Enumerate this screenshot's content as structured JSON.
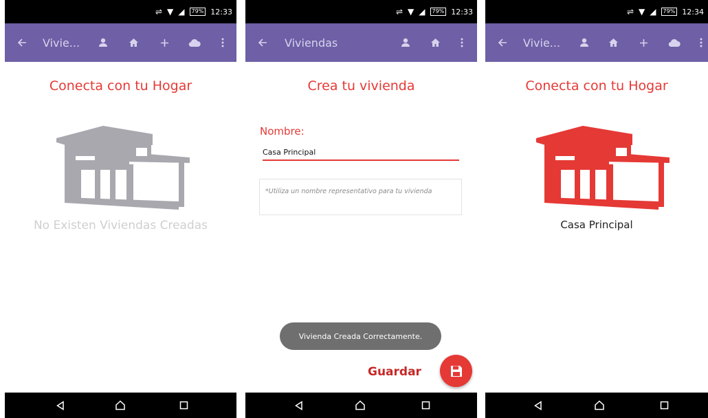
{
  "colors": {
    "accent": "#e53935",
    "appbar": "#6e5fa6",
    "house_gray": "#a8a8ae",
    "house_red": "#e53935"
  },
  "status": {
    "battery": "79%",
    "time1": "12:33",
    "time2": "12:33",
    "time3": "12:34"
  },
  "screen1": {
    "appbar_title": "Vivie...",
    "icons": [
      "back-arrow-icon",
      "person-icon",
      "home-icon",
      "add-icon",
      "cloud-icon",
      "more-vert-icon"
    ],
    "heading": "Conecta con tu Hogar",
    "empty_text": "No Existen Viviendas Creadas"
  },
  "screen2": {
    "appbar_title": "Viviendas",
    "icons": [
      "back-arrow-icon",
      "person-icon",
      "home-icon",
      "more-vert-icon"
    ],
    "heading": "Crea tu vivienda",
    "name_label": "Nombre:",
    "name_value": "Casa Principal",
    "hint": "*Utiliza un nombre representativo para tu vivienda",
    "toast": "Vivienda Creada Correctamente.",
    "save_label": "Guardar",
    "save_icon": "floppy-disk-icon"
  },
  "screen3": {
    "appbar_title": "Vivie...",
    "icons": [
      "back-arrow-icon",
      "person-icon",
      "home-icon",
      "add-icon",
      "cloud-icon",
      "more-vert-icon"
    ],
    "heading": "Conecta con tu Hogar",
    "house_name": "Casa Principal"
  },
  "navbar": {
    "icons": [
      "back-triangle-icon",
      "home-circle-icon",
      "recents-square-icon"
    ]
  }
}
